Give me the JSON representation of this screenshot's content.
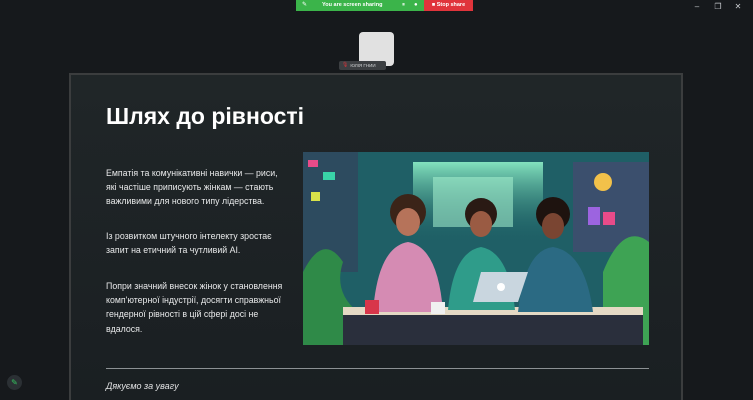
{
  "share_bar": {
    "status_text": "You are screen sharing",
    "stop_label": "Stop share",
    "color_share": "#3bb44a",
    "color_stop": "#e0343b"
  },
  "window_controls": {
    "minimize": "–",
    "restore": "❐",
    "close": "✕"
  },
  "participant": {
    "name": "ЮЛІЯ ГНИИ"
  },
  "slide": {
    "title": "Шлях до рівності",
    "paragraphs": [
      "Емпатія та комунікативні навички — риси, які частіше приписують жінкам — стають важливими для нового типу лідерства.",
      "Із розвитком штучного інтелекту зростає запит на етичний та чутливий АІ.",
      "Попри значний внесок жінок у становлення комп'ютерної індустрії, досягти справжньої гендерної рівності в цій сфері досі не вдалося."
    ],
    "image_description": "three women working at laptops in a neon futuristic office",
    "footer": "Дякуємо за увагу"
  }
}
